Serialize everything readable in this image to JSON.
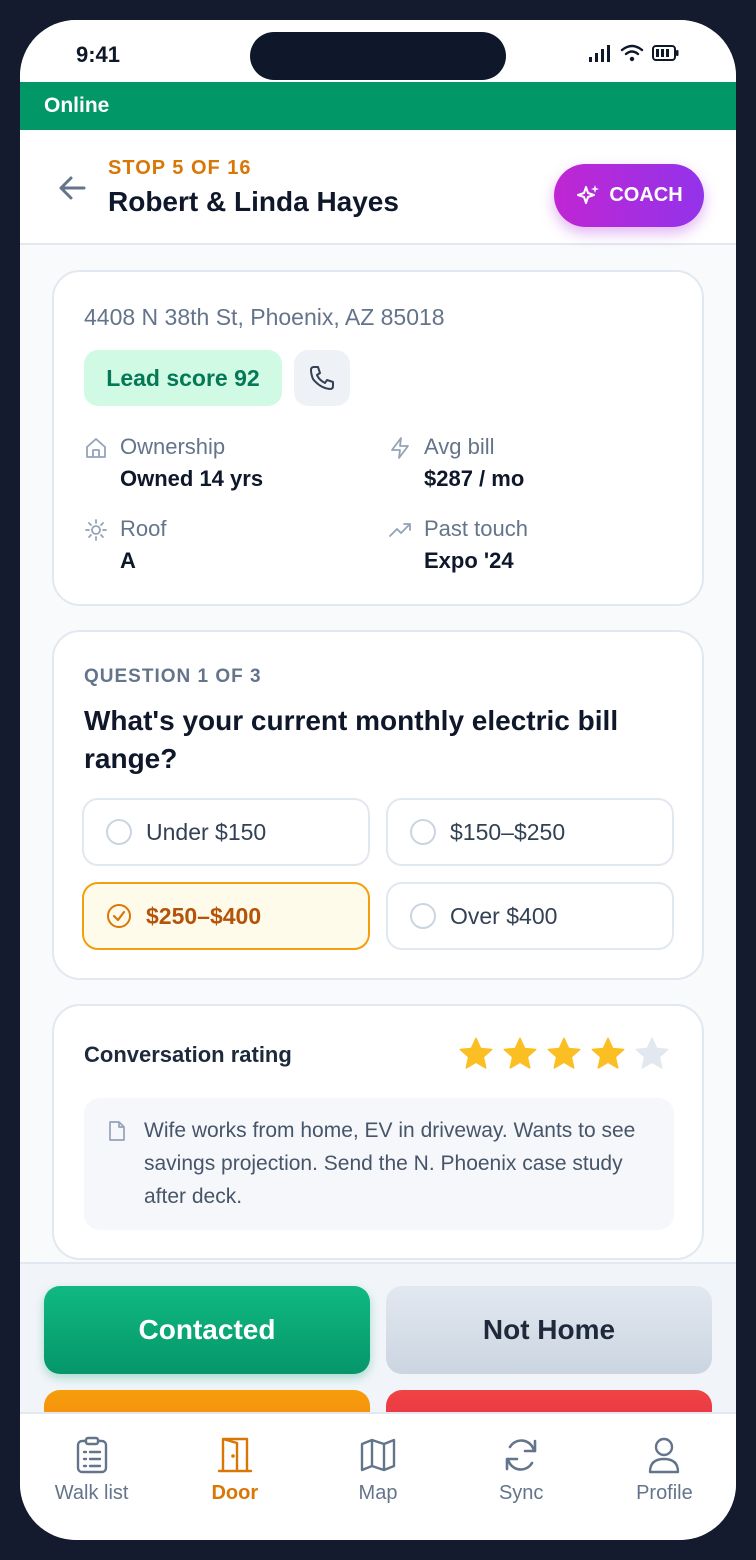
{
  "status_bar": {
    "time": "9:41"
  },
  "connection": {
    "status": "Online"
  },
  "header": {
    "stop_label": "STOP 5 OF 16",
    "lead_name": "Robert & Linda Hayes",
    "coach_label": "COACH"
  },
  "lead": {
    "address": "4408 N 38th St, Phoenix, AZ 85018",
    "lead_score": "Lead score 92",
    "stats": {
      "ownership": {
        "label": "Ownership",
        "value": "Owned 14 yrs"
      },
      "avg_bill": {
        "label": "Avg bill",
        "value": "$287 / mo"
      },
      "roof": {
        "label": "Roof",
        "value": "A"
      },
      "past_touch": {
        "label": "Past touch",
        "value": "Expo '24"
      }
    }
  },
  "question": {
    "counter": "QUESTION 1 OF 3",
    "text": "What's your current monthly electric bill range?",
    "options": [
      "Under $150",
      "$150–$250",
      "$250–$400",
      "Over $400"
    ],
    "selected": "$250–$400"
  },
  "rating": {
    "label": "Conversation rating",
    "value": 4,
    "max": 5,
    "note": "Wife works from home, EV in driveway. Wants to see savings projection. Send the N. Phoenix case study after deck."
  },
  "actions": {
    "contacted": "Contacted",
    "not_home": "Not Home"
  },
  "nav": {
    "items": [
      {
        "label": "Walk list",
        "icon": "clipboard-list-icon"
      },
      {
        "label": "Door",
        "icon": "door-icon"
      },
      {
        "label": "Map",
        "icon": "map-icon"
      },
      {
        "label": "Sync",
        "icon": "sync-icon"
      },
      {
        "label": "Profile",
        "icon": "user-icon"
      }
    ],
    "active": "Door"
  },
  "colors": {
    "online": "#019766",
    "accent": "#d97706",
    "coach": "#c026d3",
    "contacted": "#10b981",
    "star_filled": "#fbbf24",
    "star_empty": "#e2e8f0"
  }
}
